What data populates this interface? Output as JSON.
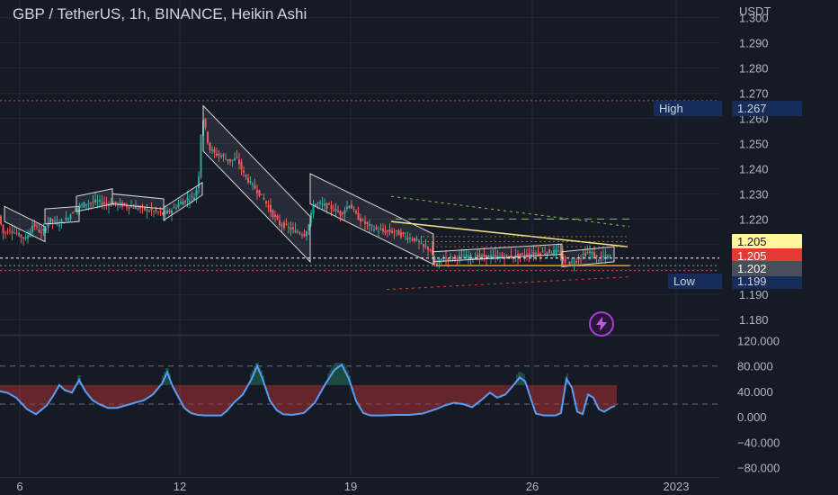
{
  "header": {
    "title": "GBP / TetherUS, 1h, BINANCE, Heikin Ashi",
    "currency": "USDT"
  },
  "labels": {
    "high_text": "High",
    "high_value": "1.267",
    "low_text": "Low",
    "low_value": "1.199",
    "price_yellow": "1.205",
    "price_red": "1.205",
    "price_gray": "1.202"
  },
  "colors": {
    "background": "#161a25",
    "up": "#26a69a",
    "down": "#ef5350",
    "oscillator": "#5b9cf6",
    "channel": "#d8d8d8",
    "trendline": "#f5e68c",
    "support": "#ff9800",
    "yellow_label": "#fff59d",
    "grid": "#232735",
    "axis_text": "#b2b5be"
  },
  "icons": {
    "flash": "lightning-bolt-icon"
  },
  "chart_data": [
    {
      "type": "candlestick",
      "style": "Heikin Ashi",
      "title": "GBP / TetherUS, 1h, BINANCE, Heikin Ashi",
      "currency": "USDT",
      "x_ticks": [
        "6",
        "12",
        "19",
        "26",
        "2023"
      ],
      "y_ticks": [
        1.18,
        1.19,
        1.2,
        1.21,
        1.22,
        1.23,
        1.24,
        1.25,
        1.26,
        1.27,
        1.28,
        1.29,
        1.3
      ],
      "y_tick_labels": [
        "1.180",
        "1.190",
        "",
        "",
        "1.220",
        "1.230",
        "1.240",
        "1.250",
        "1.260",
        "1.270",
        "1.280",
        "1.290",
        "1.300"
      ],
      "ylim": [
        1.174,
        1.307
      ],
      "price_markers": {
        "high": 1.267,
        "low": 1.199,
        "last_yellow": 1.205,
        "last_red": 1.205,
        "last_gray": 1.202
      },
      "close_path": [
        [
          0,
          1.221
        ],
        [
          5,
          1.214
        ],
        [
          12,
          1.216
        ],
        [
          20,
          1.214
        ],
        [
          30,
          1.212
        ],
        [
          38,
          1.218
        ],
        [
          48,
          1.214
        ],
        [
          56,
          1.22
        ],
        [
          65,
          1.218
        ],
        [
          75,
          1.22
        ],
        [
          85,
          1.224
        ],
        [
          95,
          1.226
        ],
        [
          108,
          1.227
        ],
        [
          120,
          1.226
        ],
        [
          130,
          1.226
        ],
        [
          145,
          1.225
        ],
        [
          160,
          1.224
        ],
        [
          172,
          1.223
        ],
        [
          182,
          1.222
        ],
        [
          190,
          1.223
        ],
        [
          200,
          1.226
        ],
        [
          210,
          1.228
        ],
        [
          218,
          1.229
        ],
        [
          222,
          1.236
        ],
        [
          226,
          1.262
        ],
        [
          230,
          1.255
        ],
        [
          234,
          1.248
        ],
        [
          240,
          1.246
        ],
        [
          248,
          1.245
        ],
        [
          256,
          1.243
        ],
        [
          265,
          1.244
        ],
        [
          272,
          1.238
        ],
        [
          280,
          1.234
        ],
        [
          288,
          1.231
        ],
        [
          296,
          1.227
        ],
        [
          304,
          1.222
        ],
        [
          312,
          1.218
        ],
        [
          320,
          1.217
        ],
        [
          330,
          1.215
        ],
        [
          340,
          1.214
        ],
        [
          345,
          1.218
        ],
        [
          350,
          1.226
        ],
        [
          356,
          1.226
        ],
        [
          365,
          1.225
        ],
        [
          372,
          1.224
        ],
        [
          380,
          1.222
        ],
        [
          390,
          1.226
        ],
        [
          398,
          1.221
        ],
        [
          408,
          1.218
        ],
        [
          418,
          1.216
        ],
        [
          428,
          1.215
        ],
        [
          440,
          1.215
        ],
        [
          452,
          1.213
        ],
        [
          462,
          1.212
        ],
        [
          472,
          1.209
        ],
        [
          480,
          1.208
        ],
        [
          485,
          1.201
        ],
        [
          492,
          1.204
        ],
        [
          510,
          1.205
        ],
        [
          530,
          1.205
        ],
        [
          550,
          1.205
        ],
        [
          570,
          1.205
        ],
        [
          590,
          1.206
        ],
        [
          610,
          1.207
        ],
        [
          622,
          1.207
        ],
        [
          630,
          1.202
        ],
        [
          640,
          1.203
        ],
        [
          650,
          1.206
        ],
        [
          658,
          1.207
        ],
        [
          665,
          1.204
        ],
        [
          672,
          1.205
        ],
        [
          680,
          1.205
        ]
      ]
    },
    {
      "type": "bar",
      "name": "oscillator",
      "y_ticks": [
        -80,
        -40,
        0,
        40,
        80,
        120
      ],
      "y_tick_labels": [
        "−80.000",
        "−40.000",
        "0.000",
        "40.000",
        "80.000",
        "120.000"
      ],
      "ylim": [
        -95,
        125
      ],
      "line_path": [
        [
          0,
          40
        ],
        [
          8,
          38
        ],
        [
          18,
          30
        ],
        [
          30,
          12
        ],
        [
          40,
          4
        ],
        [
          52,
          18
        ],
        [
          60,
          35
        ],
        [
          66,
          50
        ],
        [
          72,
          42
        ],
        [
          80,
          38
        ],
        [
          88,
          58
        ],
        [
          95,
          40
        ],
        [
          103,
          26
        ],
        [
          110,
          20
        ],
        [
          120,
          14
        ],
        [
          130,
          14
        ],
        [
          140,
          18
        ],
        [
          150,
          22
        ],
        [
          160,
          26
        ],
        [
          170,
          35
        ],
        [
          180,
          52
        ],
        [
          186,
          70
        ],
        [
          192,
          48
        ],
        [
          198,
          32
        ],
        [
          205,
          14
        ],
        [
          212,
          6
        ],
        [
          220,
          3
        ],
        [
          228,
          2
        ],
        [
          238,
          2
        ],
        [
          246,
          2
        ],
        [
          252,
          9
        ],
        [
          260,
          22
        ],
        [
          270,
          35
        ],
        [
          280,
          60
        ],
        [
          286,
          80
        ],
        [
          292,
          60
        ],
        [
          300,
          26
        ],
        [
          308,
          10
        ],
        [
          315,
          4
        ],
        [
          325,
          3
        ],
        [
          338,
          6
        ],
        [
          350,
          22
        ],
        [
          362,
          52
        ],
        [
          372,
          74
        ],
        [
          380,
          82
        ],
        [
          388,
          60
        ],
        [
          396,
          25
        ],
        [
          404,
          6
        ],
        [
          412,
          2
        ],
        [
          425,
          2
        ],
        [
          440,
          3
        ],
        [
          455,
          3
        ],
        [
          470,
          5
        ],
        [
          485,
          12
        ],
        [
          495,
          18
        ],
        [
          505,
          22
        ],
        [
          515,
          20
        ],
        [
          525,
          15
        ],
        [
          535,
          26
        ],
        [
          545,
          38
        ],
        [
          553,
          30
        ],
        [
          562,
          35
        ],
        [
          570,
          48
        ],
        [
          578,
          62
        ],
        [
          584,
          56
        ],
        [
          590,
          30
        ],
        [
          596,
          5
        ],
        [
          605,
          2
        ],
        [
          618,
          2
        ],
        [
          624,
          6
        ],
        [
          630,
          60
        ],
        [
          636,
          46
        ],
        [
          642,
          8
        ],
        [
          648,
          4
        ],
        [
          654,
          35
        ],
        [
          660,
          30
        ],
        [
          666,
          12
        ],
        [
          672,
          8
        ],
        [
          680,
          15
        ],
        [
          684,
          17
        ]
      ]
    }
  ]
}
